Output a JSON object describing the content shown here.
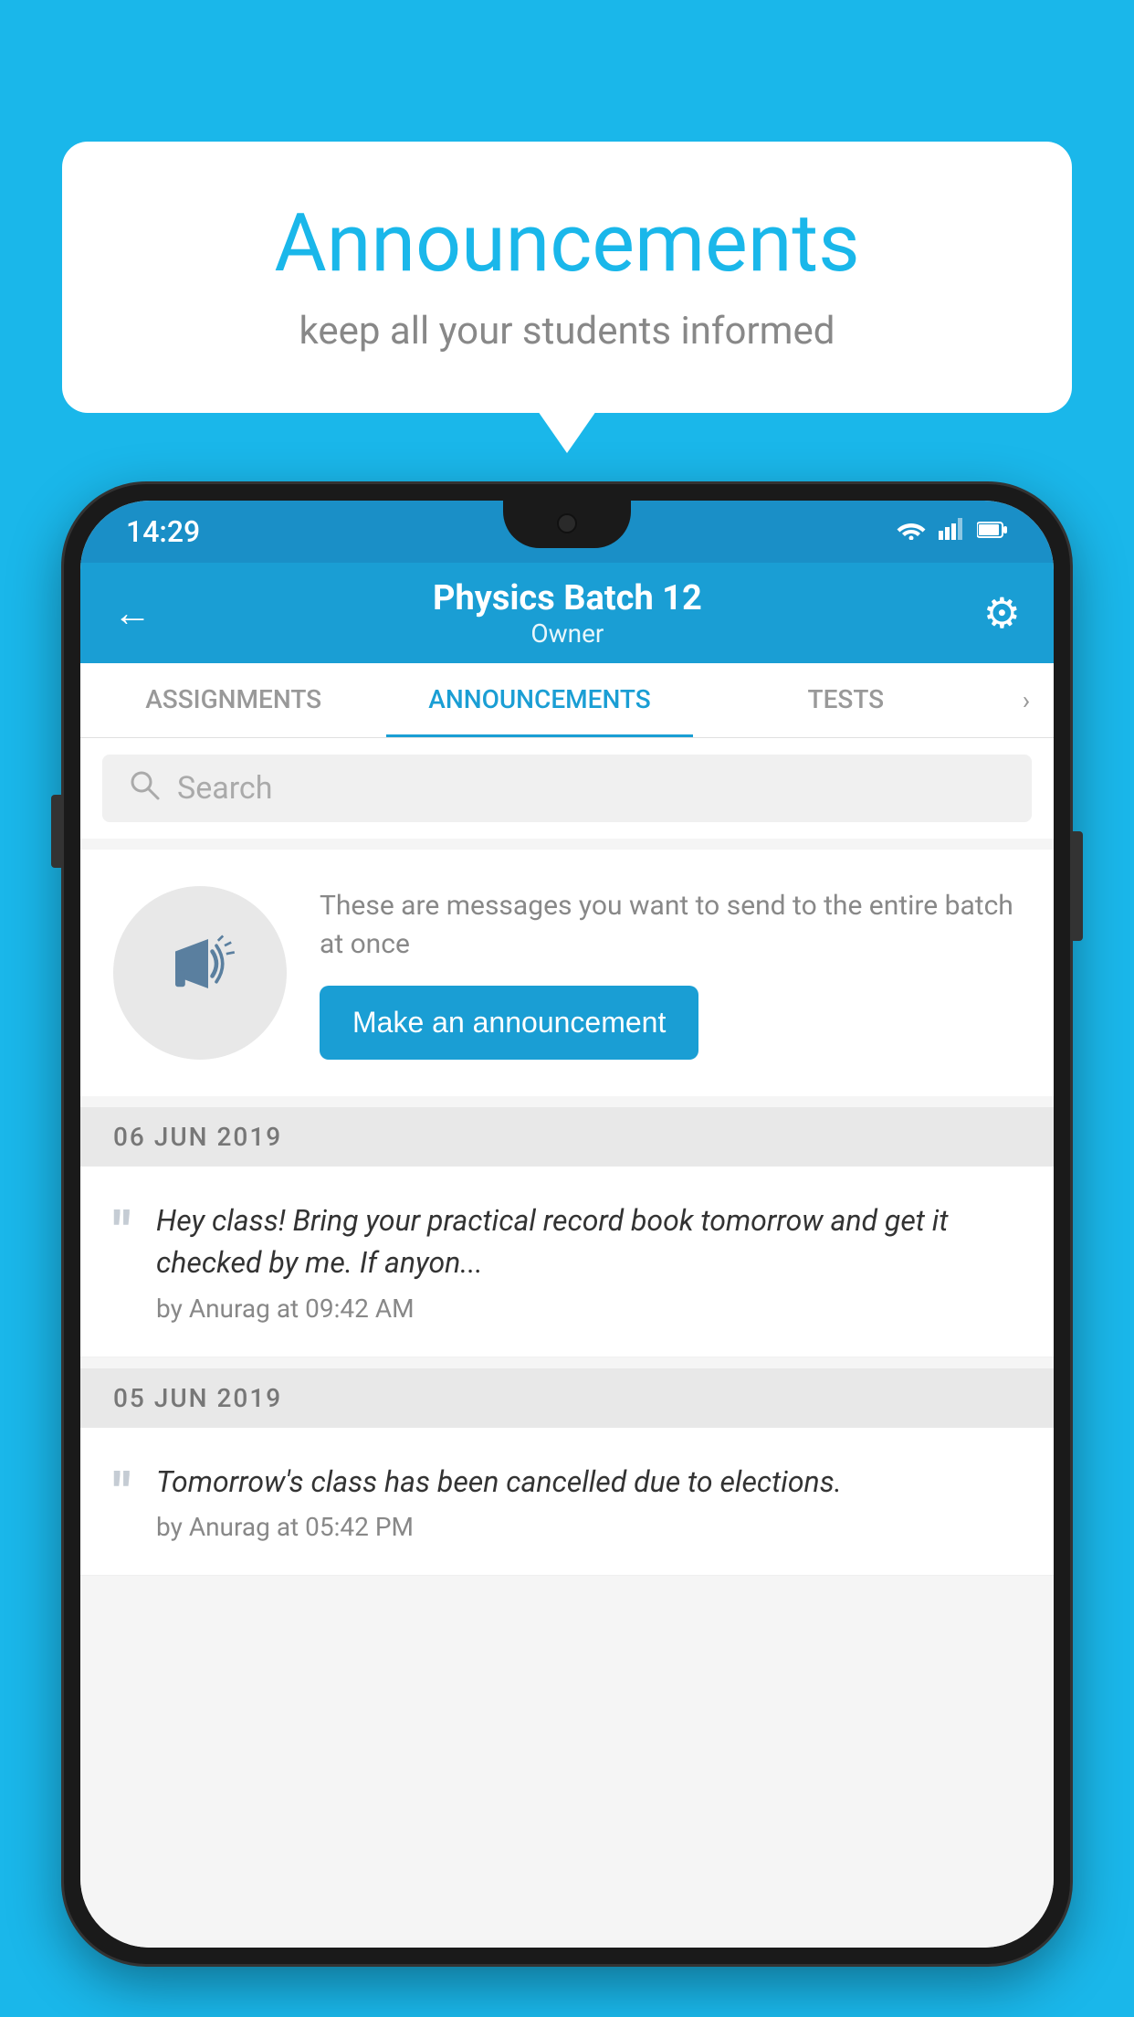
{
  "background_color": "#1ab7ea",
  "speech_bubble": {
    "title": "Announcements",
    "subtitle": "keep all your students informed"
  },
  "status_bar": {
    "time": "14:29",
    "wifi_icon": "wifi",
    "signal_icon": "signal",
    "battery_icon": "battery"
  },
  "app_bar": {
    "title": "Physics Batch 12",
    "subtitle": "Owner",
    "back_label": "←",
    "settings_label": "⚙"
  },
  "tabs": [
    {
      "label": "ASSIGNMENTS",
      "active": false
    },
    {
      "label": "ANNOUNCEMENTS",
      "active": true
    },
    {
      "label": "TESTS",
      "active": false
    }
  ],
  "search": {
    "placeholder": "Search"
  },
  "promo": {
    "description": "These are messages you want to send to the entire batch at once",
    "button_label": "Make an announcement"
  },
  "date_groups": [
    {
      "date": "06  JUN  2019",
      "announcements": [
        {
          "text": "Hey class! Bring your practical record book tomorrow and get it checked by me. If anyon...",
          "meta": "by Anurag at 09:42 AM"
        }
      ]
    },
    {
      "date": "05  JUN  2019",
      "announcements": [
        {
          "text": "Tomorrow's class has been cancelled due to elections.",
          "meta": "by Anurag at 05:42 PM"
        }
      ]
    }
  ],
  "icons": {
    "megaphone": "📣",
    "quote": "“",
    "search": "🔍",
    "back": "←",
    "settings": "⚙"
  }
}
